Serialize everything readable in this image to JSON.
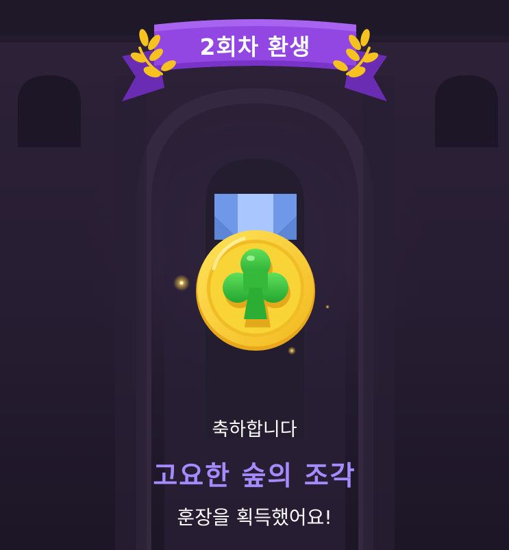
{
  "banner": {
    "label": "2회차 환생"
  },
  "medal": {
    "icon": "club-icon",
    "colors": {
      "gold": "#f7d23a",
      "club": "#3cc43c",
      "ribbon": "#7fa7ef",
      "banner": "#8a3cd8"
    }
  },
  "message": {
    "congrats": "축하합니다",
    "medal_name": "고요한 숲의 조각",
    "acquired": "훈장을 획득했어요!"
  },
  "theme": {
    "background": "#2d2238",
    "accent_text": "#a48bff"
  }
}
